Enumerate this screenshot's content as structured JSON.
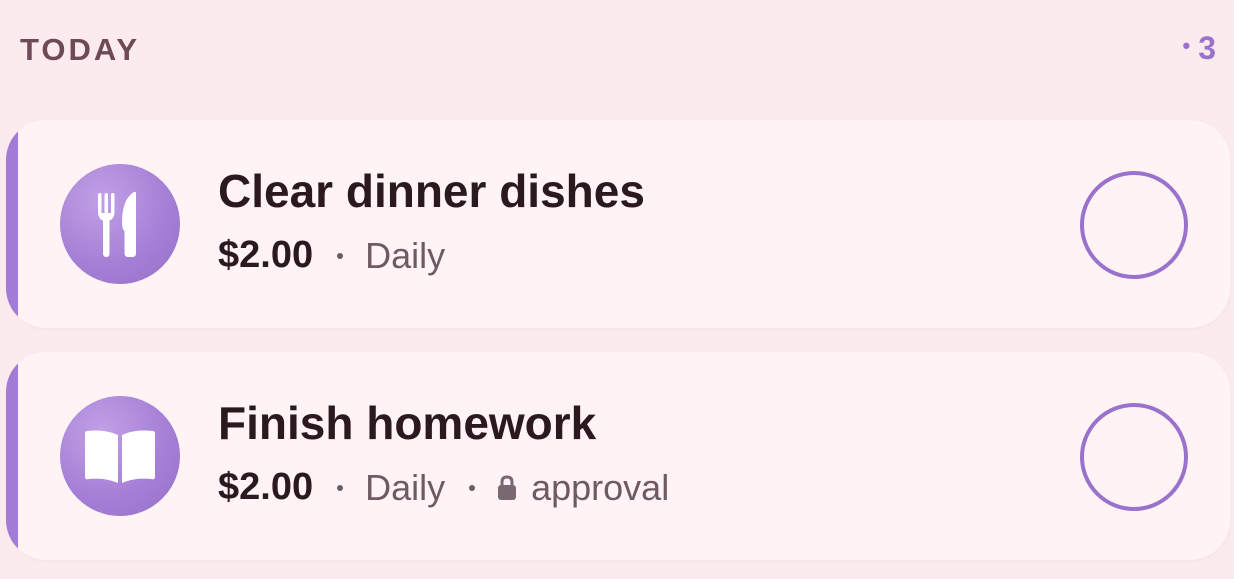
{
  "section": {
    "title": "TODAY",
    "count": "3"
  },
  "chores": [
    {
      "title": "Clear dinner dishes",
      "amount": "$2.00",
      "frequency": "Daily",
      "icon": "fork-knife-icon",
      "approval": null
    },
    {
      "title": "Finish homework",
      "amount": "$2.00",
      "frequency": "Daily",
      "icon": "book-icon",
      "approval": "approval"
    }
  ],
  "colors": {
    "accent": "#9b72cb",
    "background": "#fbeaee",
    "card": "#fff3f5"
  }
}
